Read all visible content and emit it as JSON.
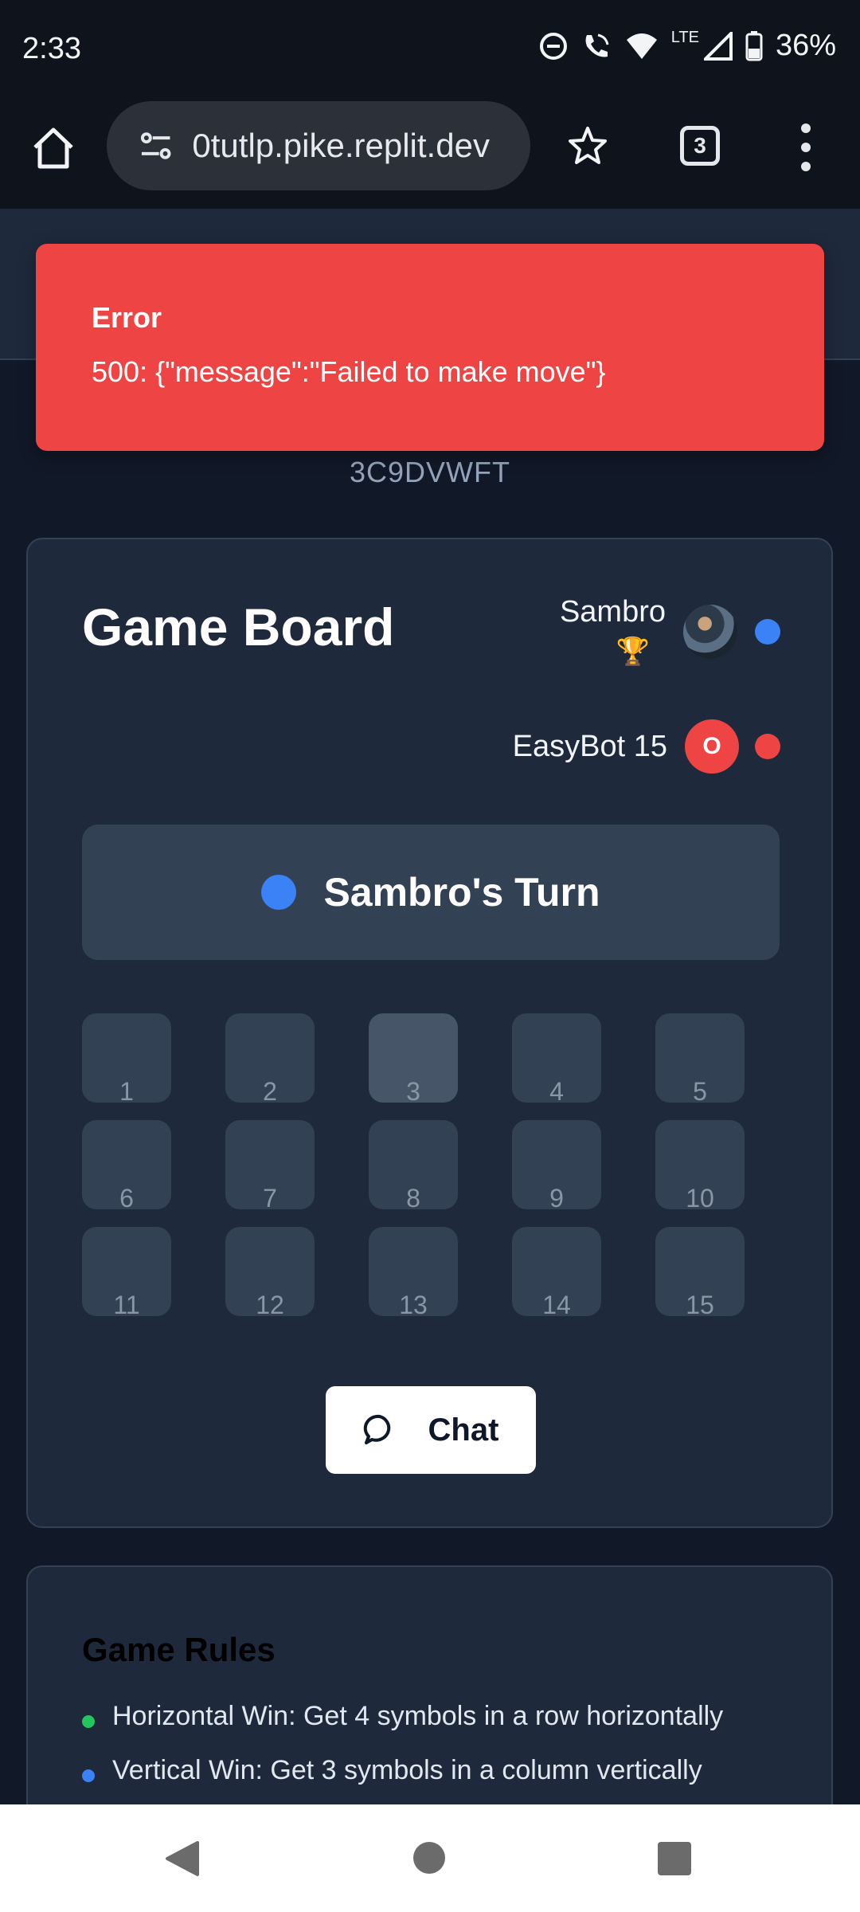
{
  "status_bar": {
    "time": "2:33",
    "network": "LTE",
    "battery": "36%"
  },
  "browser": {
    "url": "0tutlp.pike.replit.dev",
    "tab_count": "3"
  },
  "page": {
    "game_code": "3C9DVWFT",
    "board_title": "Game Board",
    "player1": {
      "name": "Sambro",
      "trophy": "🏆",
      "color": "#3b82f6"
    },
    "player2": {
      "name": "EasyBot 15",
      "badge": "O",
      "color": "#ef4444"
    },
    "turn_text": "Sambro's Turn",
    "cells": [
      "1",
      "2",
      "3",
      "4",
      "5",
      "6",
      "7",
      "8",
      "9",
      "10",
      "11",
      "12",
      "13",
      "14",
      "15"
    ],
    "chat_label": "Chat"
  },
  "rules": {
    "title": "Game Rules",
    "items": [
      {
        "text": "Horizontal Win: Get 4 symbols in a row horizontally",
        "color": "#22c55e"
      },
      {
        "text": "Vertical Win: Get 3 symbols in a column vertically",
        "color": "#3b82f6"
      }
    ]
  },
  "toast": {
    "title": "Error",
    "message": "500: {\"message\":\"Failed to make move\"}"
  }
}
